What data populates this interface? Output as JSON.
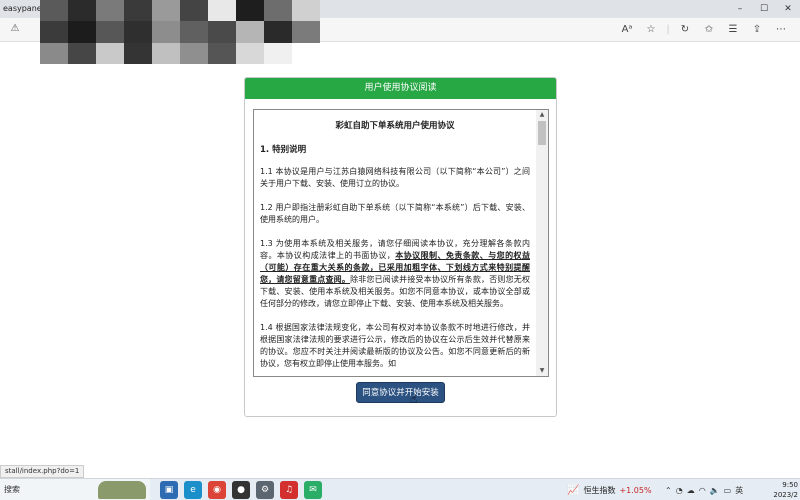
{
  "browser": {
    "tab_title": "easypanel 应",
    "window_controls": {
      "minimize": "–",
      "maximize": "☐",
      "close": "✕"
    },
    "address_icon": "warning-icon",
    "toolbar_icons": [
      "read-aloud-icon",
      "favorite-star-icon",
      "refresh-sync-icon",
      "collections-icon",
      "favorites-bar-icon",
      "share-icon",
      "more-icon"
    ]
  },
  "dialog": {
    "header": "用户使用协议阅读",
    "doc_title": "彩虹自助下单系统用户使用协议",
    "section1_head": "1. 特别说明",
    "p1_1": "1.1 本协议是用户与江苏白猿网络科技有限公司（以下简称“本公司”）之间关于用户下载、安装、使用订立的协议。",
    "p1_2": "1.2 用户即指注册彩虹自助下单系统（以下简称“本系统”）后下载、安装、使用系统的用户。",
    "p1_3_pre": "1.3 为使用本系统及相关服务，请您仔细阅读本协议，充分理解各条款内容。本协议构成法律上的书面协议，",
    "p1_3_bold": "本协议限制、免责条款、与您的权益（可能）存在重大关系的条款，已采用加粗字体、下划线方式来特别提醒您，请您留意重点查阅。",
    "p1_3_post": "除非您已阅读并接受本协议所有条款，否则您无权下载、安装、使用本系统及相关服务。如您不同意本协议，或本协议全部或任何部分的修改，请您立即停止下载、安装、使用本系统及相关服务。",
    "p1_4": "1.4 根据国家法律法规变化，本公司有权对本协议条款不时地进行修改，并根据国家法律法规的要求进行公示，修改后的协议在公示后生效并代替原来的协议。您应不时关注并阅读最新版的协议及公告。如您不同意更新后的新协议，您有权立即停止使用本服务。如",
    "agree_button": "同意协议并开始安装"
  },
  "status_url": "stall/index.php?do=1",
  "taskbar": {
    "search_placeholder": "搜索",
    "apps": [
      "store-icon",
      "edge-icon",
      "chrome-icon",
      "app-icon",
      "settings-icon",
      "netease-music-icon",
      "wechat-icon"
    ],
    "stock_name": "恒生指数",
    "stock_change": "+1.05%",
    "ime": "英",
    "time": "9:50",
    "date": "2023/2"
  },
  "colors": {
    "header_green": "#28a745",
    "button_blue": "#2c5282",
    "stock_red": "#c62828"
  }
}
